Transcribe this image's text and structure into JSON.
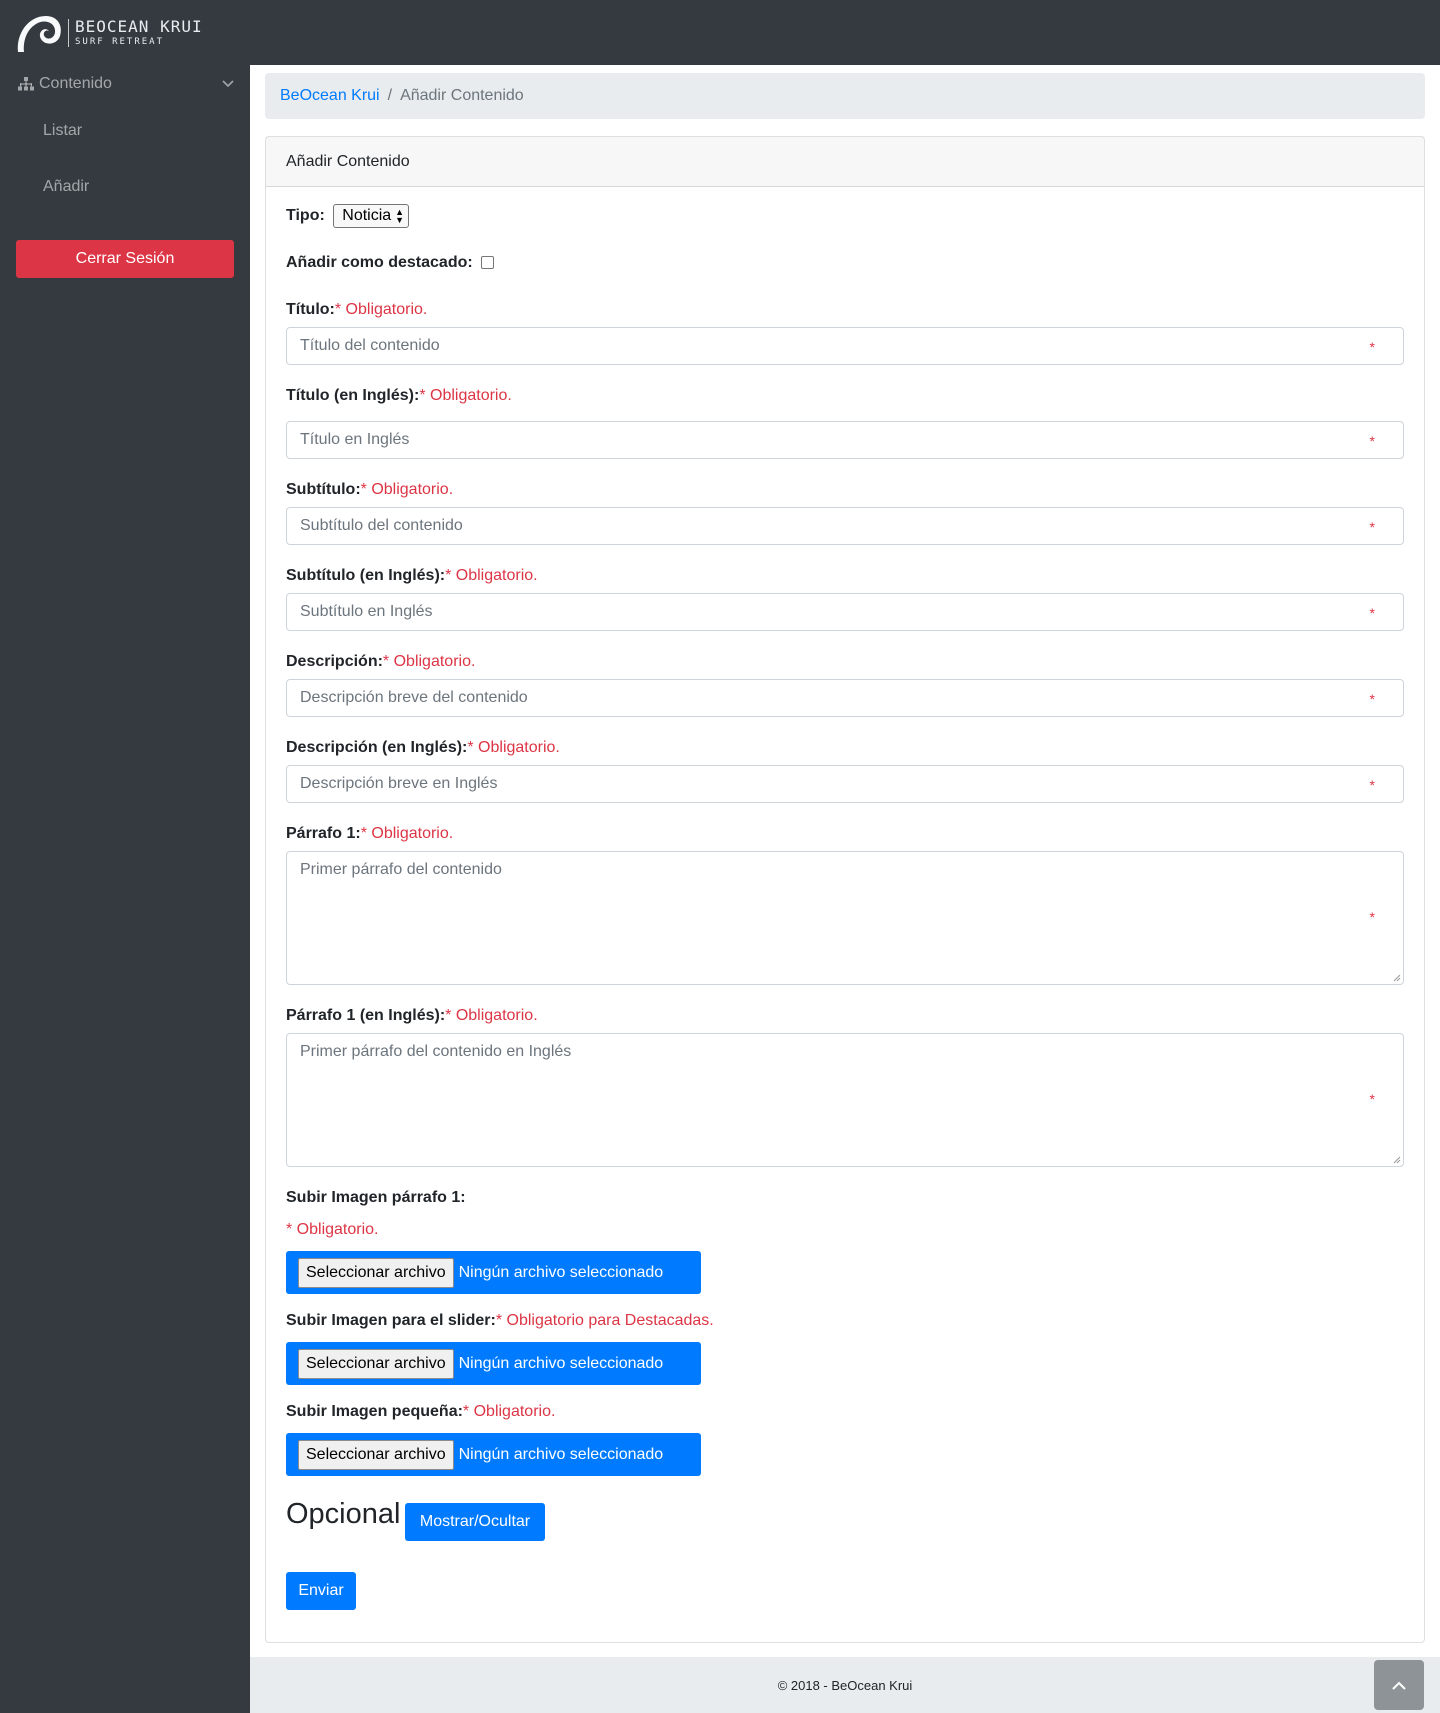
{
  "brand": {
    "line1": "BEOCEAN KRUI",
    "line2": "SURF RETREAT"
  },
  "sidebar": {
    "group_label": "Contenido",
    "items": [
      {
        "label": "Listar"
      },
      {
        "label": "Añadir"
      }
    ],
    "logout_label": "Cerrar Sesión"
  },
  "breadcrumb": {
    "home": "BeOcean Krui",
    "separator": "/",
    "current": "Añadir Contenido"
  },
  "form": {
    "title": "Añadir Contenido",
    "type": {
      "label": "Tipo:",
      "selected": "Noticia"
    },
    "featured": {
      "label": "Añadir como destacado:",
      "checked": false
    },
    "required_marker": "*",
    "fields": [
      {
        "label": "Título:",
        "req": "* Obligatorio.",
        "placeholder": "Título del contenido"
      },
      {
        "label": "Título (en Inglés):",
        "req": "* Obligatorio.",
        "placeholder": "Título en Inglés"
      },
      {
        "label": "Subtítulo:",
        "req": "* Obligatorio.",
        "placeholder": "Subtítulo del contenido"
      },
      {
        "label": "Subtítulo (en Inglés):",
        "req": "* Obligatorio.",
        "placeholder": "Subtítulo en Inglés"
      },
      {
        "label": "Descripción:",
        "req": "* Obligatorio.",
        "placeholder": "Descripción breve del contenido"
      },
      {
        "label": "Descripción (en Inglés):",
        "req": "* Obligatorio.",
        "placeholder": "Descripción breve en Inglés"
      },
      {
        "label": "Párrafo 1:",
        "req": "* Obligatorio.",
        "placeholder": "Primer párrafo del contenido"
      },
      {
        "label": "Párrafo 1 (en Inglés):",
        "req": "* Obligatorio.",
        "placeholder": "Primer párrafo del contenido en Inglés"
      }
    ],
    "uploads": [
      {
        "label": "Subir Imagen párrafo 1:",
        "req": "* Obligatorio.",
        "button": "Seleccionar archivo",
        "status": "Ningún archivo seleccionado"
      },
      {
        "label": "Subir Imagen para el slider:",
        "req": "* Obligatorio para Destacadas.",
        "button": "Seleccionar archivo",
        "status": "Ningún archivo seleccionado"
      },
      {
        "label": "Subir Imagen pequeña:",
        "req": "* Obligatorio.",
        "button": "Seleccionar archivo",
        "status": "Ningún archivo seleccionado"
      }
    ],
    "optional": {
      "title": "Opcional",
      "toggle_label": "Mostrar/Ocultar"
    },
    "submit_label": "Enviar"
  },
  "footer": {
    "text": "© 2018 - BeOcean Krui"
  },
  "colors": {
    "sidebar": "#343a40",
    "primary": "#007bff",
    "danger": "#dc3545",
    "light": "#e9ecef"
  },
  "icons": {
    "nav_group": "sitemap-icon",
    "expand": "chevron-down-icon",
    "scroll_top": "chevron-up-icon"
  }
}
